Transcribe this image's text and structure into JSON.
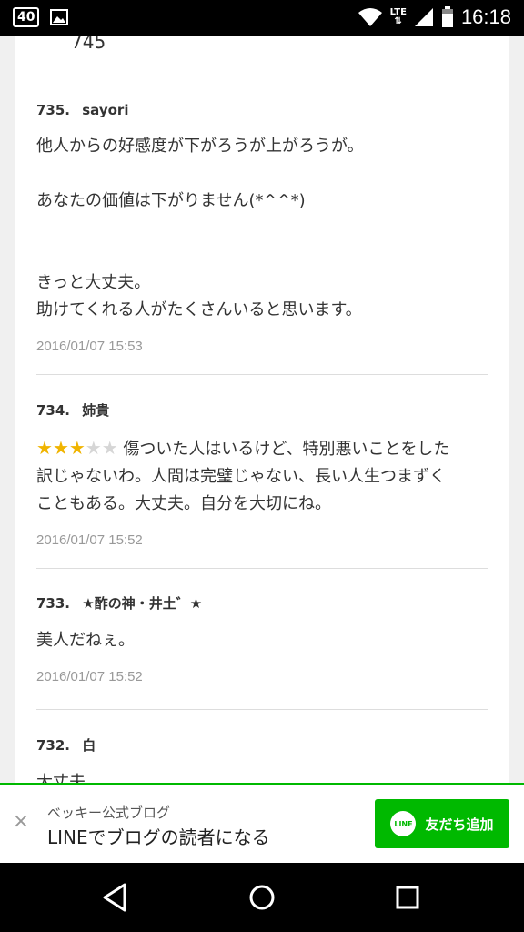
{
  "status_bar": {
    "badge": "40",
    "network": "LTE",
    "time": "16:18"
  },
  "prev_entry_number": "745",
  "comments": [
    {
      "number": "735.",
      "author": "sayori",
      "lines": [
        "他人からの好感度が下がろうが上がろうが。",
        "",
        "あなたの価値は下がりません(*^^*)",
        "",
        "",
        "きっと大丈夫。",
        "助けてくれる人がたくさんいると思います。"
      ],
      "date": "2016/01/07 15:53"
    },
    {
      "number": "734.",
      "author": "姉貴",
      "rating": 3,
      "rating_max": 5,
      "lines": [
        "傷ついた人はいるけど、特別悪いことをした",
        "訳じゃないわ。人間は完璧じゃない、長い人生つまずく",
        "こともある。大丈夫。自分を大切にね。"
      ],
      "date": "2016/01/07 15:52"
    },
    {
      "number": "733.",
      "author": "★酢の神・井土゛★",
      "lines": [
        "美人だねぇ。"
      ],
      "date": "2016/01/07 15:52"
    },
    {
      "number": "732.",
      "author": "白",
      "lines": [
        "大丈夫。"
      ]
    }
  ],
  "banner": {
    "subtitle": "ベッキー公式ブログ",
    "title": "LINEでブログの読者になる",
    "button_label": "友だち追加",
    "logo_text": "LINE",
    "accent_color": "#00b900"
  },
  "nav": {
    "back": "back-icon",
    "home": "home-icon",
    "recents": "recents-icon"
  }
}
